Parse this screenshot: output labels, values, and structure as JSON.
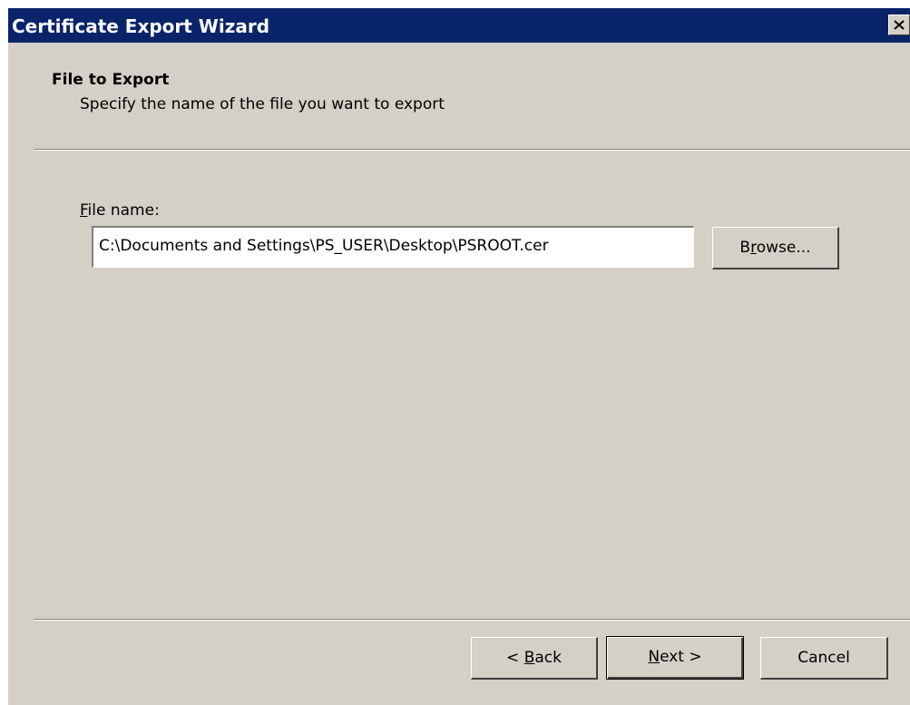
{
  "window": {
    "title": "Certificate Export Wizard",
    "close_icon": "close-icon"
  },
  "header": {
    "title": "File to Export",
    "subtitle": "Specify the name of the file you want to export"
  },
  "file_field": {
    "label_mnemonic": "F",
    "label_rest": "ile name:",
    "value": "C:\\Documents and Settings\\PS_USER\\Desktop\\PSROOT.cer"
  },
  "browse_button": {
    "pre": "B",
    "mnemonic": "r",
    "post": "owse..."
  },
  "footer": {
    "back": {
      "pre": "< ",
      "mnemonic": "B",
      "post": "ack"
    },
    "next": {
      "pre": "",
      "mnemonic": "N",
      "post": "ext >"
    },
    "cancel": "Cancel"
  },
  "colors": {
    "titlebar": "#0a246a",
    "face": "#d4d0c8"
  }
}
